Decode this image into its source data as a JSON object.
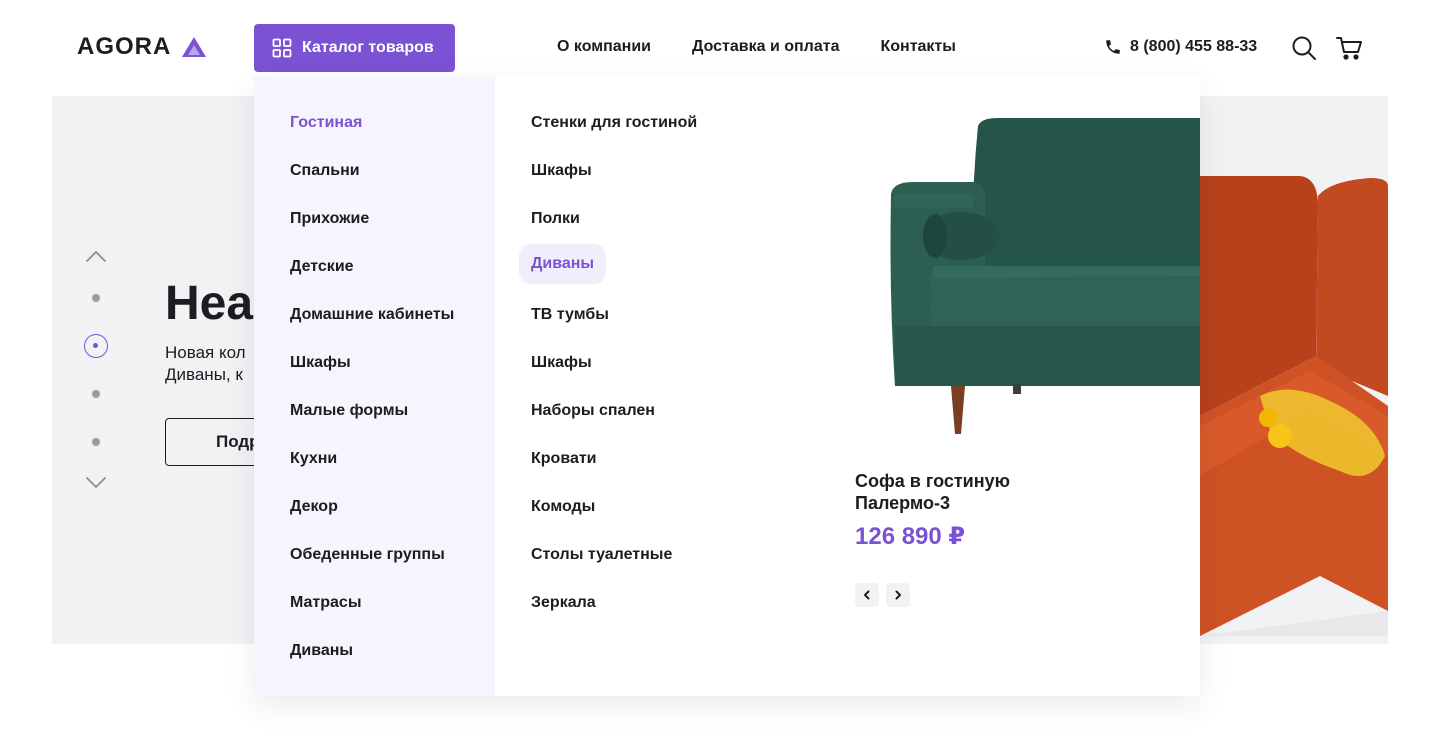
{
  "header": {
    "logo": "AGORA",
    "catalog_label": "Каталог товаров",
    "nav": [
      "О компании",
      "Доставка и оплата",
      "Контакты"
    ],
    "phone": "8 (800) 455 88-33"
  },
  "hero": {
    "title": "Неа",
    "subtitle_line1": "Новая кол",
    "subtitle_line2": "Диваны, к",
    "button_label": "Подр"
  },
  "dropdown": {
    "categories": [
      "Гостиная",
      "Спальни",
      "Прихожие",
      "Детские",
      "Домашние кабинеты",
      "Шкафы",
      "Малые формы",
      "Кухни",
      "Декор",
      "Обеденные группы",
      "Матрасы",
      "Диваны"
    ],
    "active_category": "Гостиная",
    "subcategories": [
      "Стенки для гостиной",
      "Шкафы",
      "Полки",
      "Диваны",
      "ТВ тумбы",
      "Шкафы",
      "Наборы спален",
      "Кровати",
      "Комоды",
      "Столы туалетные",
      "Зеркала"
    ],
    "active_subcategory": "Диваны",
    "product": {
      "name": "Софа в гостиную Палермо-3",
      "price": "126 890 ₽"
    }
  },
  "colors": {
    "accent": "#7b52d3",
    "hero_bg": "#f2f2f4",
    "menu_bg": "#f6f4fd",
    "sofa_green": "#2b5a4d",
    "sofa_orange": "#c8471f"
  },
  "icons": [
    "grid-icon",
    "phone-icon",
    "search-icon",
    "cart-icon",
    "chevron-up-icon",
    "chevron-down-icon",
    "chevron-left-icon",
    "chevron-right-icon"
  ]
}
